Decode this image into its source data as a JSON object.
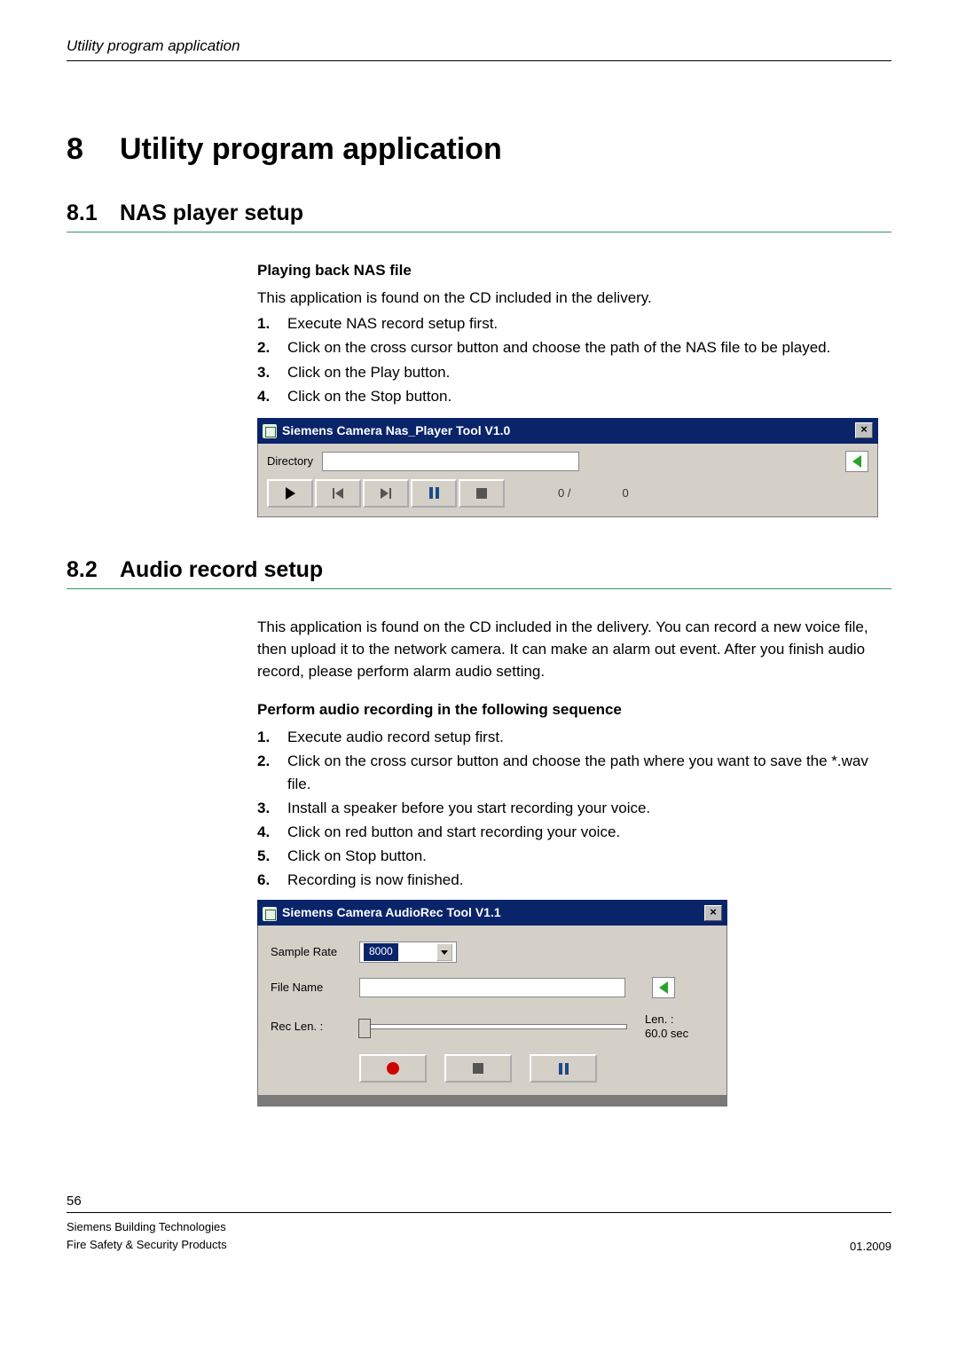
{
  "running_header": "Utility program application",
  "chapter": {
    "num": "8",
    "title": "Utility program application"
  },
  "section1": {
    "num": "8.1",
    "title": "NAS player setup",
    "subheading": "Playing back NAS file",
    "intro": "This application is found on the CD included in the delivery.",
    "steps": [
      "Execute NAS record setup first.",
      "Click on the cross cursor button and choose the path of the NAS file to be played.",
      "Click on the Play button.",
      "Click on the Stop button."
    ]
  },
  "nas_window": {
    "title": "Siemens Camera Nas_Player Tool V1.0",
    "directory_label": "Directory",
    "directory_value": "",
    "counter1": "0  /",
    "counter2": "0"
  },
  "section2": {
    "num": "8.2",
    "title": "Audio record setup",
    "intro": "This application is found on the CD included in the delivery. You can record a new voice file, then upload it to the network camera. It can make an alarm out event. After you finish audio record, please perform alarm audio setting.",
    "subheading": "Perform audio recording in the following sequence",
    "steps": [
      "Execute audio record setup first.",
      "Click on the cross cursor button and choose the path where you want to save the *.wav file.",
      "Install a speaker before you start recording your voice.",
      "Click on red button and start recording your voice.",
      "Click on Stop button.",
      "Recording is now finished."
    ]
  },
  "audio_window": {
    "title": "Siemens Camera AudioRec Tool V1.1",
    "sample_rate_label": "Sample Rate",
    "sample_rate_value": "8000",
    "file_name_label": "File Name",
    "file_name_value": "",
    "rec_len_label": "Rec Len. :",
    "len_label": "Len. :",
    "len_value": "60.0 sec"
  },
  "footer": {
    "page_num": "56",
    "line1": "Siemens Building Technologies",
    "line2": "Fire Safety & Security Products",
    "date": "01.2009"
  }
}
